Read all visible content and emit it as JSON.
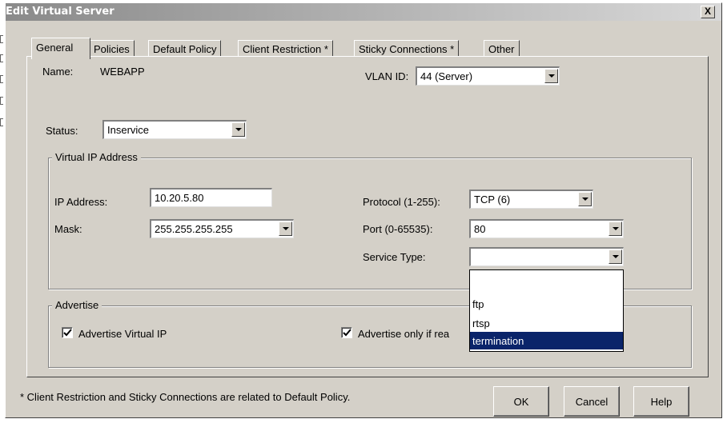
{
  "window": {
    "title": "Edit Virtual Server",
    "close_label": "X"
  },
  "tabs": [
    {
      "label": "General",
      "active": true
    },
    {
      "label": "Policies",
      "active": false
    },
    {
      "label": "Default Policy",
      "active": false
    },
    {
      "label": "Client Restriction *",
      "active": false
    },
    {
      "label": "Sticky Connections *",
      "active": false
    },
    {
      "label": "Other",
      "active": false
    }
  ],
  "general": {
    "name_label": "Name:",
    "name_value": "WEBAPP",
    "vlan_label": "VLAN ID:",
    "vlan_value": "44 (Server)",
    "status_label": "Status:",
    "status_value": "Inservice"
  },
  "virtual_ip": {
    "legend": "Virtual IP Address",
    "ip_label": "IP Address:",
    "ip_value": "10.20.5.80",
    "mask_label": "Mask:",
    "mask_value": "255.255.255.255",
    "protocol_label": "Protocol (1-255):",
    "protocol_value": "TCP (6)",
    "port_label": "Port (0-65535):",
    "port_value": "80",
    "service_type_label": "Service Type:",
    "service_type_value": "",
    "service_type_options": [
      "",
      "ftp",
      "rtsp",
      "termination"
    ],
    "service_type_highlighted": "termination"
  },
  "advertise": {
    "legend": "Advertise",
    "advertise_vip_label": "Advertise Virtual IP",
    "advertise_vip_checked": true,
    "advertise_only_label": "Advertise only if rea",
    "advertise_only_checked": true
  },
  "footer": {
    "note": "* Client Restriction and Sticky Connections are related to Default Policy.",
    "ok_label": "OK",
    "cancel_label": "Cancel",
    "help_label": "Help"
  },
  "side_id": "126866",
  "colors": {
    "dialog_bg": "#d4d0c8",
    "selection_bg": "#0a246a",
    "selection_fg": "#ffffff"
  }
}
